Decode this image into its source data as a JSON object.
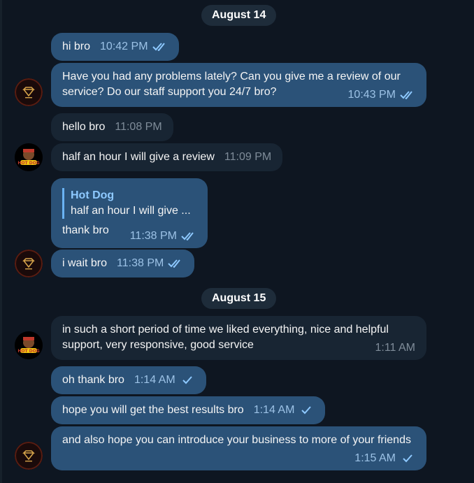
{
  "dates": [
    "August 14",
    "August 15"
  ],
  "messages": [
    {
      "text": "hi bro",
      "time": "10:42 PM",
      "status": "read"
    },
    {
      "text": "Have you had any problems lately? Can you give me a review of our service? Do our staff support you 24/7 bro?",
      "time": "10:43 PM",
      "status": "read"
    },
    {
      "text": "hello bro",
      "time": "11:08 PM"
    },
    {
      "text": "half an hour I will give a review",
      "time": "11:09 PM"
    },
    {
      "reply_name": "Hot Dog",
      "reply_text": "half an hour I will give ...",
      "text": "thank bro",
      "time": "11:38 PM",
      "status": "read"
    },
    {
      "text": "i wait bro",
      "time": "11:38 PM",
      "status": "read"
    },
    {
      "text": "in such a short period of time we liked everything, nice and helpful support, very responsive, good service",
      "time": "1:11 AM"
    },
    {
      "text": "oh thank bro",
      "time": "1:14 AM",
      "status": "sent"
    },
    {
      "text": "hope you will get the best results bro",
      "time": "1:14 AM",
      "status": "sent"
    },
    {
      "text": "and also hope you can introduce your business to more of your friends",
      "time": "1:15 AM",
      "status": "sent"
    }
  ],
  "avatars": {
    "outgoing": "diamond-logo-avatar",
    "incoming": "hot-dog-avatar",
    "incoming_label": "HOT DOG"
  },
  "colors": {
    "background": "#0e1621",
    "outgoing_bubble": "#2b5278",
    "incoming_bubble": "#182533",
    "check": "#6ab3f3"
  }
}
